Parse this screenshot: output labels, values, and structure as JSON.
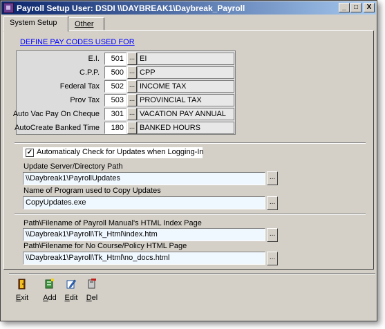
{
  "window": {
    "title": "Payroll Setup  User: DSDI  \\\\DAYBREAK1\\Daybreak_Payroll",
    "minimize": "_",
    "maximize": "□",
    "close": "X"
  },
  "tabs": [
    {
      "label": "System Setup",
      "active": true
    },
    {
      "label": "Other",
      "active": false
    }
  ],
  "pay_codes": {
    "heading": "DEFINE PAY CODES USED FOR",
    "rows": [
      {
        "label": "E.I.",
        "code": "501",
        "desc": "EI"
      },
      {
        "label": "C.P.P.",
        "code": "500",
        "desc": "CPP"
      },
      {
        "label": "Federal Tax",
        "code": "502",
        "desc": "INCOME TAX"
      },
      {
        "label": "Prov Tax",
        "code": "503",
        "desc": "PROVINCIAL TAX"
      },
      {
        "label": "Auto Vac Pay On Cheque",
        "code": "301",
        "desc": "VACATION PAY ANNUAL"
      },
      {
        "label": "AutoCreate Banked Time",
        "code": "180",
        "desc": "BANKED HOURS"
      }
    ],
    "lookup_btn": "..."
  },
  "updates": {
    "auto_check_label": "Automaticaly Check for Updates when Logging-In",
    "auto_check_checked": true,
    "server_label": "Update Server/Directory Path",
    "server_value": "\\\\Daybreak1\\PayrollUpdates",
    "program_label": "Name of Program used to Copy Updates",
    "program_value": "CopyUpdates.exe"
  },
  "help": {
    "manual_label": "Path\\Filename of Payroll Manual's HTML Index Page",
    "manual_value": "\\\\Daybreak1\\Payroll\\Tk_Html\\index.htm",
    "nocourse_label": "Path\\Filename for No Course/Policy HTML Page",
    "nocourse_value": "\\\\Daybreak1\\Payroll\\Tk_Html\\no_docs.html"
  },
  "browse_btn": "...",
  "toolbar": {
    "exit": {
      "hot": "E",
      "rest": "xit"
    },
    "add": {
      "hot": "A",
      "rest": "dd"
    },
    "edit": {
      "hot": "E",
      "rest": "dit"
    },
    "del": {
      "hot": "D",
      "rest": "el"
    }
  },
  "colors": {
    "titlebar_start": "#0a246a",
    "titlebar_end": "#a6caf0",
    "face": "#d4d0c8",
    "link": "#0000ff"
  }
}
